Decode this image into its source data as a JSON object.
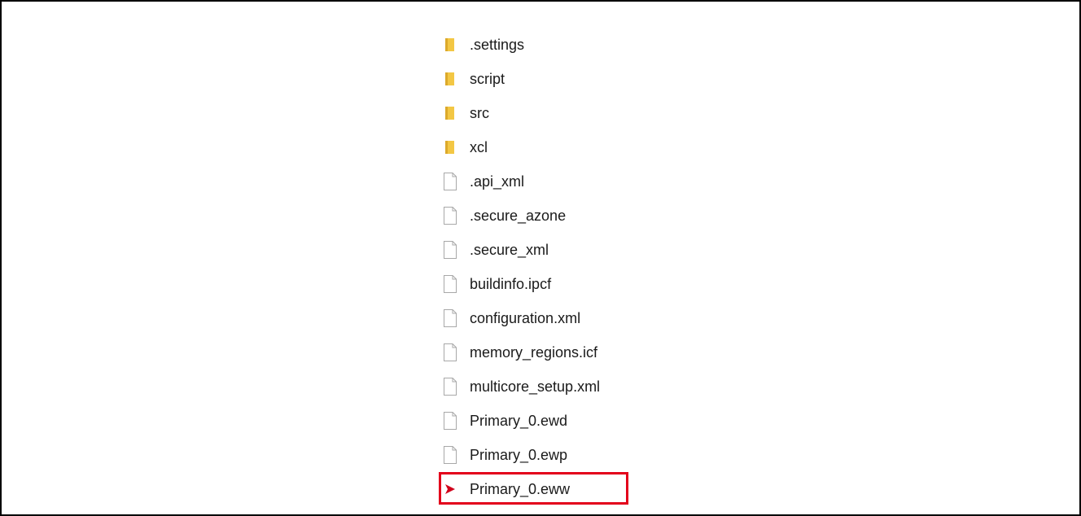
{
  "explorer": {
    "items": [
      {
        "name": ".settings",
        "icon": "folder-icon"
      },
      {
        "name": "script",
        "icon": "folder-icon"
      },
      {
        "name": "src",
        "icon": "folder-icon"
      },
      {
        "name": "xcl",
        "icon": "folder-icon"
      },
      {
        "name": ".api_xml",
        "icon": "file-icon"
      },
      {
        "name": ".secure_azone",
        "icon": "file-icon"
      },
      {
        "name": ".secure_xml",
        "icon": "file-icon"
      },
      {
        "name": "buildinfo.ipcf",
        "icon": "file-icon"
      },
      {
        "name": "configuration.xml",
        "icon": "file-icon"
      },
      {
        "name": "memory_regions.icf",
        "icon": "file-icon"
      },
      {
        "name": "multicore_setup.xml",
        "icon": "file-icon"
      },
      {
        "name": "Primary_0.ewd",
        "icon": "file-icon"
      },
      {
        "name": "Primary_0.ewp",
        "icon": "file-icon"
      },
      {
        "name": "Primary_0.eww",
        "icon": "iar-workspace-icon",
        "highlighted": true
      }
    ]
  },
  "colors": {
    "highlight_border": "#e3001b",
    "folder_yellow": "#f3c744",
    "folder_dark": "#dca92b",
    "workspace_icon_red": "#d0021b"
  }
}
